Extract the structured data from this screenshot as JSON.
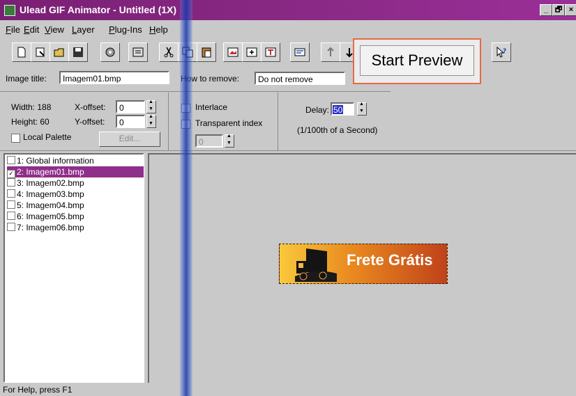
{
  "window": {
    "title": "Ulead GIF Animator - Untitled (1X)",
    "controls": [
      "_",
      "🗗",
      "×"
    ]
  },
  "menu": [
    "File",
    "Edit",
    "View",
    "Layer",
    "Plug-Ins",
    "Help"
  ],
  "menu_mnemonics": [
    "F",
    "E",
    "V",
    "L",
    "P",
    "H"
  ],
  "toolbar": {
    "icons": [
      "new-icon",
      "open-wizard-icon",
      "open-icon",
      "save-icon",
      "optimize-icon",
      "properties-icon",
      "cut-icon",
      "copy-icon",
      "paste-icon",
      "add-image-icon",
      "add-frame-icon",
      "add-text-icon",
      "banner-text-icon",
      "move-up-icon",
      "move-down-icon",
      "help-pointer-icon"
    ],
    "preview_button": "Start Preview"
  },
  "image_props": {
    "title_label": "Image title:",
    "title_value": "Imagem01.bmp",
    "remove_label": "How to remove:",
    "remove_value": "Do not remove"
  },
  "frame_props": {
    "width_label": "Width: 188",
    "height_label": "Height: 60",
    "xoffset_label": "X-offset:",
    "xoffset_value": "0",
    "yoffset_label": "Y-offset:",
    "yoffset_value": "0",
    "local_palette_label": "Local Palette",
    "edit_button": "Edit...",
    "interlace_label": "Interlace",
    "transparent_label": "Transparent index",
    "transparent_value": "0",
    "delay_label": "Delay:",
    "delay_value": "50",
    "delay_unit": "(1/100th of a Second)"
  },
  "frames": [
    {
      "label": "1: Global information",
      "checked": false,
      "selected": false
    },
    {
      "label": "2: Imagem01.bmp",
      "checked": true,
      "selected": true
    },
    {
      "label": "3: Imagem02.bmp",
      "checked": false,
      "selected": false
    },
    {
      "label": "4: Imagem03.bmp",
      "checked": false,
      "selected": false
    },
    {
      "label": "5: Imagem04.bmp",
      "checked": false,
      "selected": false
    },
    {
      "label": "6: Imagem05.bmp",
      "checked": false,
      "selected": false
    },
    {
      "label": "7: Imagem06.bmp",
      "checked": false,
      "selected": false
    }
  ],
  "canvas": {
    "banner_text": "Frete Grátis",
    "banner_icon": "truck-icon"
  },
  "status": "For Help, press F1",
  "colors": {
    "titlebar": "#8a2a86",
    "selection": "#8f2f8b",
    "callout_border": "#e46a45",
    "delay_highlight": "#2a31c8"
  }
}
